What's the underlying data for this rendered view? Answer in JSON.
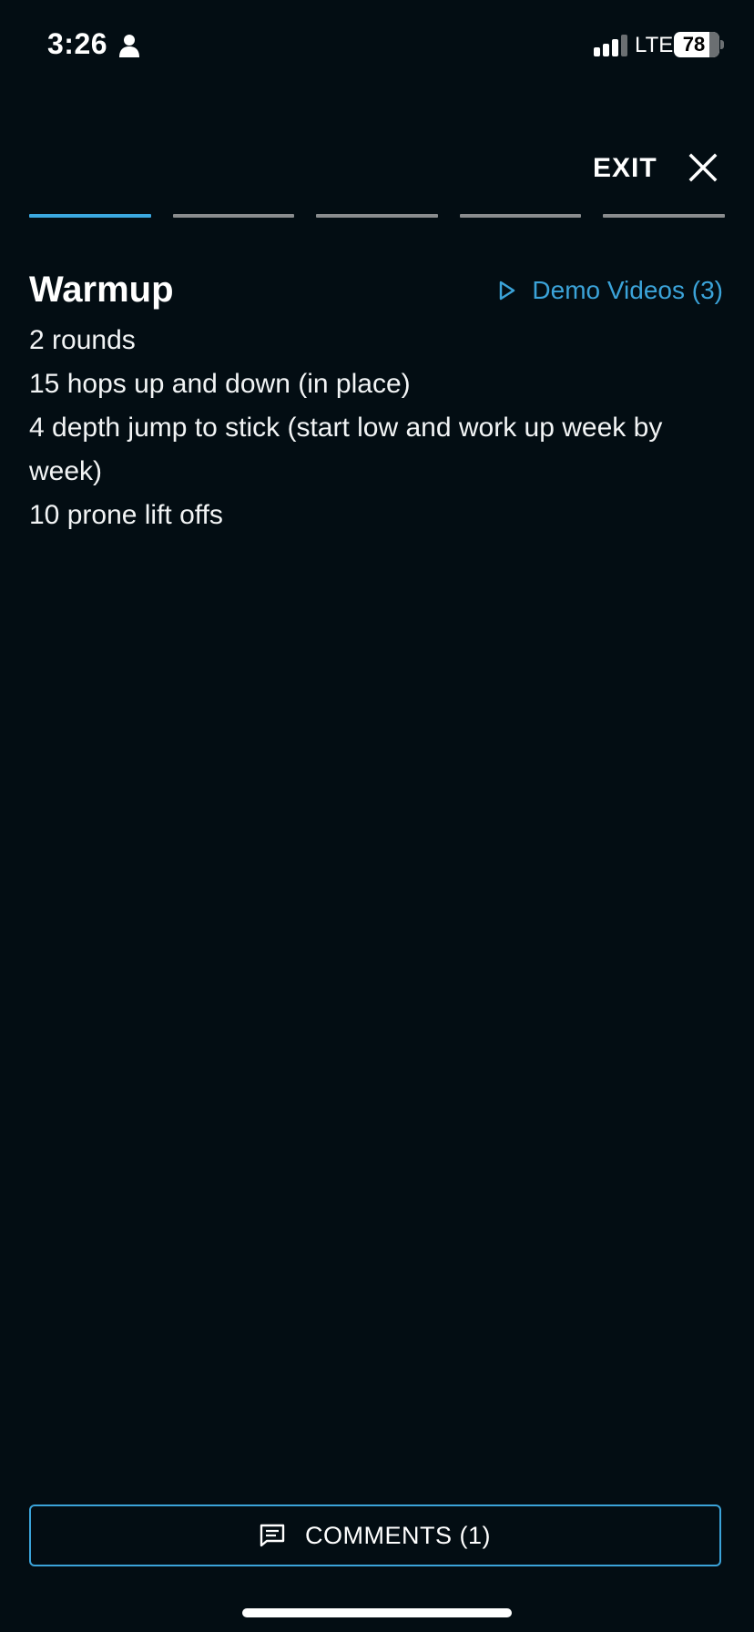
{
  "status_bar": {
    "time": "3:26",
    "network": "LTE",
    "battery": "78"
  },
  "header": {
    "exit_label": "EXIT"
  },
  "progress": {
    "total_segments": 5,
    "current_segment": 1
  },
  "section": {
    "title": "Warmup",
    "demo_link_label": "Demo Videos (3)",
    "lines": [
      "2 rounds",
      "15 hops up and down (in place)",
      "4 depth jump to stick (start low and work up week by week)",
      "10 prone lift offs"
    ]
  },
  "footer": {
    "comments_label": "COMMENTS (1)"
  },
  "colors": {
    "background": "#030d13",
    "accent": "#3ba8e0",
    "inactive_segment": "#8a8c8e"
  }
}
